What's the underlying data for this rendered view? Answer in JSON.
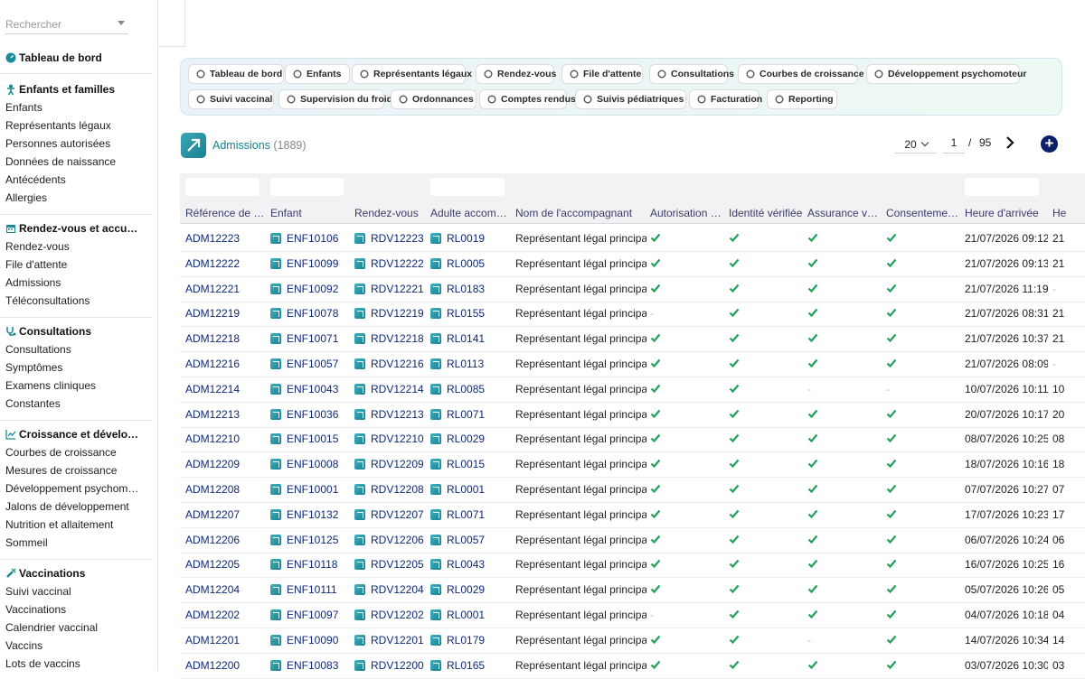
{
  "sidebar": {
    "search_placeholder": "Rechercher",
    "dashboard": "Tableau de bord",
    "groups": [
      {
        "title": "Enfants et familles",
        "icon": "child-icon",
        "items": [
          "Enfants",
          "Représentants légaux",
          "Personnes autorisées",
          "Données de naissance",
          "Antécédents",
          "Allergies"
        ]
      },
      {
        "title": "Rendez-vous et accu…",
        "icon": "calendar-icon",
        "items": [
          "Rendez-vous",
          "File d'attente",
          "Admissions",
          "Téléconsultations"
        ]
      },
      {
        "title": "Consultations",
        "icon": "stethoscope-icon",
        "items": [
          "Consultations",
          "Symptômes",
          "Examens cliniques",
          "Constantes"
        ]
      },
      {
        "title": "Croissance et dévelo…",
        "icon": "chart-line-icon",
        "items": [
          "Courbes de croissance",
          "Mesures de croissance",
          "Développement psychom…",
          "Jalons de développement",
          "Nutrition et allaitement",
          "Sommeil"
        ]
      },
      {
        "title": "Vaccinations",
        "icon": "syringe-icon",
        "items": [
          "Suivi vaccinal",
          "Vaccinations",
          "Calendrier vaccinal",
          "Vaccins",
          "Lots de vaccins"
        ]
      }
    ]
  },
  "nav": {
    "row1": [
      "Tableau de bord",
      "Enfants",
      "Représentants légaux",
      "Rendez-vous",
      "File d'attente",
      "Consultations",
      "Courbes de croissance",
      "Développement psychomoteur"
    ],
    "row2": [
      "Suivi vaccinal",
      "Supervision du froid",
      "Ordonnances",
      "Comptes rendus",
      "Suivis pédiatriques",
      "Facturation",
      "Reporting"
    ]
  },
  "header": {
    "title": "Admissions",
    "count": "(1889)",
    "page_size": "20",
    "page_current": "1",
    "page_sep": "/",
    "page_total": "95",
    "add_label": "+"
  },
  "table": {
    "columns": [
      "Référence de …",
      "Enfant",
      "Rendez-vous",
      "Adulte accom…",
      "Nom de l'accompagnant",
      "Autorisation …",
      "Identité vérifiée",
      "Assurance v…",
      "Consenteme…",
      "Heure d'arrivée",
      "He"
    ],
    "rows": [
      {
        "ref": "ADM12223",
        "enfant": "ENF10106",
        "rdv": "RDV12223",
        "adulte": "RL0019",
        "nom": "Représentant légal principal",
        "auth": true,
        "ident": true,
        "assur": true,
        "consent": true,
        "arrivee": "21/07/2026 09:12",
        "extra": "21"
      },
      {
        "ref": "ADM12222",
        "enfant": "ENF10099",
        "rdv": "RDV12222",
        "adulte": "RL0005",
        "nom": "Représentant légal principal",
        "auth": true,
        "ident": true,
        "assur": true,
        "consent": true,
        "arrivee": "21/07/2026 09:13",
        "extra": "21"
      },
      {
        "ref": "ADM12221",
        "enfant": "ENF10092",
        "rdv": "RDV12221",
        "adulte": "RL0183",
        "nom": "Représentant légal principal",
        "auth": true,
        "ident": true,
        "assur": true,
        "consent": true,
        "arrivee": "21/07/2026 11:19",
        "extra": "-"
      },
      {
        "ref": "ADM12219",
        "enfant": "ENF10078",
        "rdv": "RDV12219",
        "adulte": "RL0155",
        "nom": "Représentant légal principal",
        "auth": false,
        "ident": true,
        "assur": true,
        "consent": true,
        "arrivee": "21/07/2026 08:31",
        "extra": "21"
      },
      {
        "ref": "ADM12218",
        "enfant": "ENF10071",
        "rdv": "RDV12218",
        "adulte": "RL0141",
        "nom": "Représentant légal principal",
        "auth": true,
        "ident": true,
        "assur": true,
        "consent": true,
        "arrivee": "21/07/2026 10:37",
        "extra": "21"
      },
      {
        "ref": "ADM12216",
        "enfant": "ENF10057",
        "rdv": "RDV12216",
        "adulte": "RL0113",
        "nom": "Représentant légal principal",
        "auth": true,
        "ident": true,
        "assur": true,
        "consent": true,
        "arrivee": "21/07/2026 08:09",
        "extra": "-"
      },
      {
        "ref": "ADM12214",
        "enfant": "ENF10043",
        "rdv": "RDV12214",
        "adulte": "RL0085",
        "nom": "Représentant légal principal",
        "auth": true,
        "ident": true,
        "assur": false,
        "consent": false,
        "arrivee": "10/07/2026 10:11",
        "extra": "10"
      },
      {
        "ref": "ADM12213",
        "enfant": "ENF10036",
        "rdv": "RDV12213",
        "adulte": "RL0071",
        "nom": "Représentant légal principal",
        "auth": true,
        "ident": true,
        "assur": true,
        "consent": true,
        "arrivee": "20/07/2026 10:17",
        "extra": "20"
      },
      {
        "ref": "ADM12210",
        "enfant": "ENF10015",
        "rdv": "RDV12210",
        "adulte": "RL0029",
        "nom": "Représentant légal principal",
        "auth": true,
        "ident": true,
        "assur": true,
        "consent": true,
        "arrivee": "08/07/2026 10:25",
        "extra": "08"
      },
      {
        "ref": "ADM12209",
        "enfant": "ENF10008",
        "rdv": "RDV12209",
        "adulte": "RL0015",
        "nom": "Représentant légal principal",
        "auth": true,
        "ident": true,
        "assur": true,
        "consent": true,
        "arrivee": "18/07/2026 10:16",
        "extra": "18"
      },
      {
        "ref": "ADM12208",
        "enfant": "ENF10001",
        "rdv": "RDV12208",
        "adulte": "RL0001",
        "nom": "Représentant légal principal",
        "auth": true,
        "ident": true,
        "assur": true,
        "consent": true,
        "arrivee": "07/07/2026 10:27",
        "extra": "07"
      },
      {
        "ref": "ADM12207",
        "enfant": "ENF10132",
        "rdv": "RDV12207",
        "adulte": "RL0071",
        "nom": "Représentant légal principal",
        "auth": true,
        "ident": true,
        "assur": true,
        "consent": true,
        "arrivee": "17/07/2026 10:23",
        "extra": "17"
      },
      {
        "ref": "ADM12206",
        "enfant": "ENF10125",
        "rdv": "RDV12206",
        "adulte": "RL0057",
        "nom": "Représentant légal principal",
        "auth": true,
        "ident": true,
        "assur": true,
        "consent": true,
        "arrivee": "06/07/2026 10:24",
        "extra": "06"
      },
      {
        "ref": "ADM12205",
        "enfant": "ENF10118",
        "rdv": "RDV12205",
        "adulte": "RL0043",
        "nom": "Représentant légal principal",
        "auth": true,
        "ident": true,
        "assur": true,
        "consent": true,
        "arrivee": "16/07/2026 10:25",
        "extra": "16"
      },
      {
        "ref": "ADM12204",
        "enfant": "ENF10111",
        "rdv": "RDV12204",
        "adulte": "RL0029",
        "nom": "Représentant légal principal",
        "auth": true,
        "ident": true,
        "assur": true,
        "consent": true,
        "arrivee": "05/07/2026 10:26",
        "extra": "05"
      },
      {
        "ref": "ADM12202",
        "enfant": "ENF10097",
        "rdv": "RDV12202",
        "adulte": "RL0001",
        "nom": "Représentant légal principal",
        "auth": false,
        "ident": true,
        "assur": true,
        "consent": true,
        "arrivee": "04/07/2026 10:18",
        "extra": "04"
      },
      {
        "ref": "ADM12201",
        "enfant": "ENF10090",
        "rdv": "RDV12201",
        "adulte": "RL0179",
        "nom": "Représentant légal principal",
        "auth": true,
        "ident": true,
        "assur": false,
        "consent": true,
        "arrivee": "14/07/2026 10:34",
        "extra": "14"
      },
      {
        "ref": "ADM12200",
        "enfant": "ENF10083",
        "rdv": "RDV12200",
        "adulte": "RL0165",
        "nom": "Représentant légal principal",
        "auth": true,
        "ident": true,
        "assur": true,
        "consent": true,
        "arrivee": "03/07/2026 10:30",
        "extra": "03"
      }
    ]
  },
  "colors": {
    "accent": "#13808f",
    "link": "#0d2a78",
    "check": "#23a05a",
    "add_button": "#0b1f6b"
  }
}
